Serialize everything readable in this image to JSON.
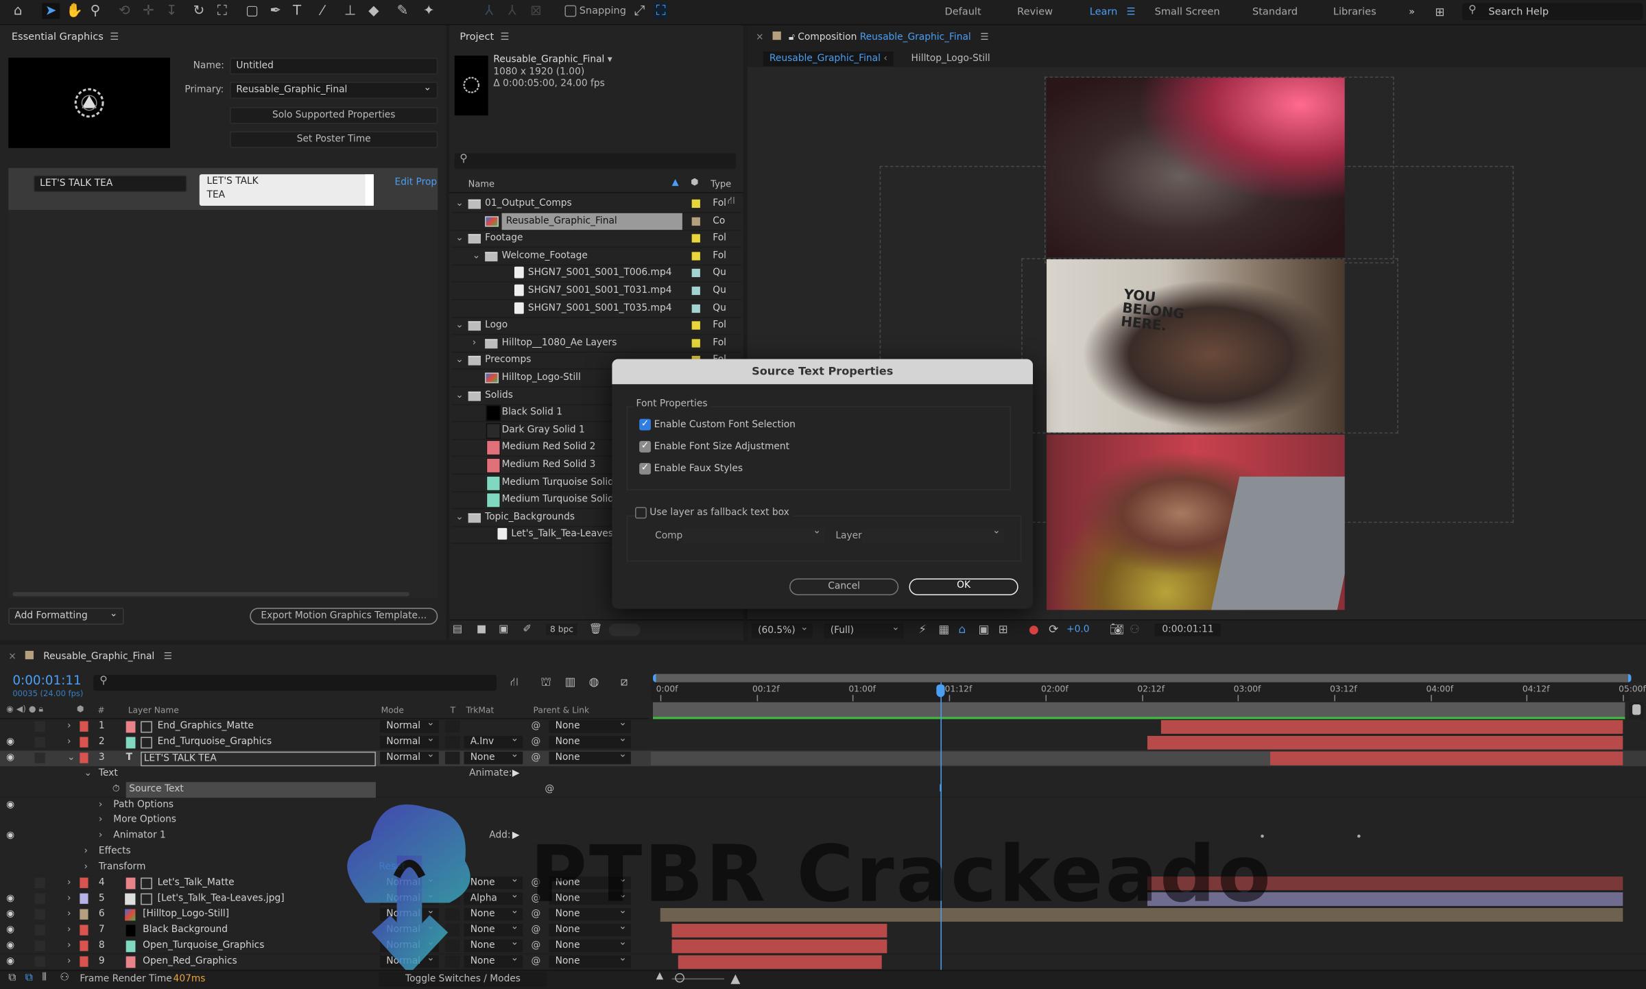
{
  "toolbar": {
    "snapping_label": "Snapping",
    "snapping_checked": false,
    "workspaces": [
      "Default",
      "Review",
      "Learn",
      "Small Screen",
      "Standard",
      "Libraries"
    ],
    "active_workspace": "Learn",
    "search_placeholder": "Search Help",
    "accent_color": "#4a9ff5"
  },
  "essential_graphics": {
    "title": "Essential Graphics",
    "name_label": "Name:",
    "name_value": "Untitled",
    "primary_label": "Primary:",
    "primary_value": "Reusable_Graphic_Final",
    "solo_button": "Solo Supported Properties",
    "poster_button": "Set Poster Time",
    "property_name": "LET'S TALK TEA",
    "property_value_line1": "LET'S TALK",
    "property_value_line2": "TEA",
    "edit_link": "Edit Prop",
    "add_formatting": "Add Formatting",
    "export_button": "Export Motion Graphics Template..."
  },
  "project": {
    "title": "Project",
    "comp_name": "Reusable_Graphic_Final",
    "comp_size": "1080 x 1920 (1.00)",
    "comp_duration": "Δ 0:00:05:00, 24.00 fps",
    "search_placeholder": "",
    "col_name": "Name",
    "col_type": "Type",
    "bpc": "8 bpc",
    "items": [
      {
        "name": "01_Output_Comps",
        "kind": "folder",
        "depth": 0,
        "open": true,
        "color": "#e8d63a",
        "type": "Fol"
      },
      {
        "name": "Reusable_Graphic_Final",
        "kind": "comp",
        "depth": 1,
        "selected": true,
        "color": "#b59f7e",
        "type": "Co"
      },
      {
        "name": "Footage",
        "kind": "folder",
        "depth": 0,
        "open": true,
        "color": "#e8d63a",
        "type": "Fol"
      },
      {
        "name": "Welcome_Footage",
        "kind": "folder",
        "depth": 1,
        "open": true,
        "color": "#e8d63a",
        "type": "Fol"
      },
      {
        "name": "SHGN7_S001_S001_T006.mp4",
        "kind": "file",
        "depth": 2,
        "color": "#a3d3d0",
        "type": "Qu"
      },
      {
        "name": "SHGN7_S001_S001_T031.mp4",
        "kind": "file",
        "depth": 2,
        "color": "#a3d3d0",
        "type": "Qu"
      },
      {
        "name": "SHGN7_S001_S001_T035.mp4",
        "kind": "file",
        "depth": 2,
        "color": "#a3d3d0",
        "type": "Qu"
      },
      {
        "name": "Logo",
        "kind": "folder",
        "depth": 0,
        "open": true,
        "color": "#e8d63a",
        "type": "Fol"
      },
      {
        "name": "Hilltop__1080_Ae Layers",
        "kind": "folder",
        "depth": 1,
        "open": false,
        "color": "#e8d63a",
        "type": "Fol"
      },
      {
        "name": "Precomps",
        "kind": "folder",
        "depth": 0,
        "open": true,
        "color": "#e8d63a",
        "type": "Fol"
      },
      {
        "name": "Hilltop_Logo-Still",
        "kind": "comp",
        "depth": 1,
        "color": "#b59f7e",
        "type": ""
      },
      {
        "name": "Solids",
        "kind": "folder",
        "depth": 0,
        "open": true,
        "color": "#e8d63a",
        "type": ""
      },
      {
        "name": "Black Solid 1",
        "kind": "solid",
        "depth": 1,
        "swatch": "#000000",
        "type": ""
      },
      {
        "name": "Dark Gray Solid 1",
        "kind": "solid",
        "depth": 1,
        "swatch": "#2a2a2a",
        "type": ""
      },
      {
        "name": "Medium Red Solid 2",
        "kind": "solid",
        "depth": 1,
        "swatch": "#e0707a",
        "type": ""
      },
      {
        "name": "Medium Red Solid 3",
        "kind": "solid",
        "depth": 1,
        "swatch": "#e0707a",
        "type": ""
      },
      {
        "name": "Medium Turquoise Solid",
        "kind": "solid",
        "depth": 1,
        "swatch": "#7fd8bf",
        "type": ""
      },
      {
        "name": "Medium Turquoise Solid",
        "kind": "solid",
        "depth": 1,
        "swatch": "#7fd8bf",
        "type": ""
      },
      {
        "name": "Topic_Backgrounds",
        "kind": "folder",
        "depth": 0,
        "open": true,
        "color": "#e8d63a",
        "type": ""
      },
      {
        "name": "Let's_Talk_Tea-Leaves.jpg",
        "kind": "file",
        "depth": 1,
        "type": ""
      }
    ]
  },
  "composition": {
    "panel_label": "Composition",
    "comp_name": "Reusable_Graphic_Final",
    "breadcrumb": [
      "Reusable_Graphic_Final",
      "Hilltop_Logo-Still"
    ],
    "zoom": "(60.5%)",
    "resolution": "(Full)",
    "exposure": "+0.0",
    "timecode": "0:00:01:11",
    "photo_text": "YOU BELONG HERE."
  },
  "dialog": {
    "title": "Source Text Properties",
    "group_label": "Font Properties",
    "options": [
      {
        "label": "Enable Custom Font Selection",
        "checked": true,
        "focused": true
      },
      {
        "label": "Enable Font Size Adjustment",
        "checked": true
      },
      {
        "label": "Enable Faux Styles",
        "checked": true
      }
    ],
    "fallback_label": "Use layer as fallback text box",
    "fallback_checked": false,
    "comp_label": "Comp:",
    "layer_label": "Layer:",
    "cancel": "Cancel",
    "ok": "OK"
  },
  "timeline": {
    "comp_name": "Reusable_Graphic_Final",
    "timecode": "0:00:01:11",
    "frame_info": "00035 (24.00 fps)",
    "current_time_s": 1.4583,
    "duration_s": 5,
    "columns": {
      "num": "#",
      "layer_name": "Layer Name",
      "mode": "Mode",
      "t": "T",
      "trkmat": "TrkMat",
      "parent": "Parent & Link"
    },
    "ruler_labels": [
      "0:00f",
      "00:12f",
      "01:00f",
      "01:12f",
      "02:00f",
      "02:12f",
      "03:00f",
      "03:12f",
      "04:00f",
      "04:12f",
      "05:00f"
    ],
    "animate_label": "Animate:",
    "add_label": "Add:",
    "reset_label": "Reset",
    "layers": [
      {
        "num": "1",
        "name": "End_Graphics_Matte",
        "label_color": "#d9534f",
        "swatch": "#e8838a",
        "mode": "Normal",
        "trkmat": "",
        "parent": "None",
        "visible": false,
        "bar": [
          2.6,
          5
        ],
        "bar_color": "#b84a4a"
      },
      {
        "num": "2",
        "name": "End_Turquoise_Graphics",
        "label_color": "#d9534f",
        "swatch": "#7fd8bf",
        "mode": "Normal",
        "trkmat": "A.Inv",
        "parent": "None",
        "visible": true,
        "bar": [
          2.53,
          5
        ],
        "bar_color": "#b84a4a"
      },
      {
        "num": "3",
        "name": "LET'S TALK TEA",
        "label_color": "#d9534f",
        "text_layer": true,
        "mode": "Normal",
        "trkmat": "None",
        "parent": "None",
        "visible": true,
        "selected": true,
        "bar": [
          3.17,
          5
        ],
        "bar_color": "#b84a4a"
      },
      {
        "prop": "Text",
        "indent": 1,
        "open": true
      },
      {
        "prop": "Source Text",
        "indent": 2,
        "stopwatch": true,
        "highlight": true
      },
      {
        "prop": "Path Options",
        "indent": 3,
        "visible": true
      },
      {
        "prop": "More Options",
        "indent": 3
      },
      {
        "prop": "Animator 1",
        "indent": 3,
        "visible": true,
        "add": true
      },
      {
        "prop": "Effects",
        "indent": 1
      },
      {
        "prop": "Transform",
        "indent": 1,
        "reset": true
      },
      {
        "num": "4",
        "name": "Let's_Talk_Matte",
        "label_color": "#d9534f",
        "swatch": "#e8838a",
        "mode": "Normal",
        "trkmat": "None",
        "parent": "None",
        "visible": false,
        "bar": [
          2.53,
          5
        ],
        "bar_color": "#7a3838"
      },
      {
        "num": "5",
        "name": "[Let's_Talk_Tea-Leaves.jpg]",
        "label_color": "#b7b3e6",
        "mode": "Normal",
        "trkmat": "Alpha",
        "parent": "None",
        "visible": true,
        "bar": [
          2.53,
          5
        ],
        "bar_color": "#6f6c90"
      },
      {
        "num": "6",
        "name": "[Hilltop_Logo-Still]",
        "label_color": "#b59f7e",
        "mode": "Normal",
        "trkmat": "None",
        "parent": "None",
        "visible": true,
        "bar": [
          0,
          5
        ],
        "bar_color": "#6e6150"
      },
      {
        "num": "7",
        "name": "Black Background",
        "label_color": "#d9534f",
        "swatch": "#000000",
        "mode": "Normal",
        "trkmat": "None",
        "parent": "None",
        "visible": true,
        "bar": [
          0.06,
          1.18
        ],
        "bar_color": "#b84a4a"
      },
      {
        "num": "8",
        "name": "Open_Turquoise_Graphics",
        "label_color": "#d9534f",
        "swatch": "#7fd8bf",
        "mode": "Normal",
        "trkmat": "None",
        "parent": "None",
        "visible": true,
        "bar": [
          0.06,
          1.18
        ],
        "bar_color": "#b84a4a"
      },
      {
        "num": "9",
        "name": "Open_Red_Graphics",
        "label_color": "#d9534f",
        "swatch": "#e8838a",
        "mode": "Normal",
        "trkmat": "None",
        "parent": "None",
        "visible": true,
        "bar": [
          0.09,
          1.15
        ],
        "bar_color": "#b84a4a"
      }
    ],
    "status_label": "Frame Render Time",
    "render_time": "407ms",
    "toggle_label": "Toggle Switches / Modes"
  },
  "watermark": "PTBR Crackeado"
}
